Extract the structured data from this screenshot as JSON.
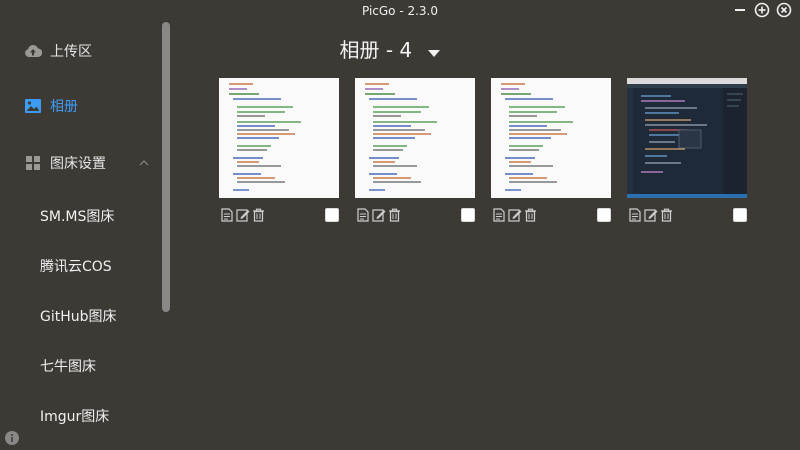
{
  "window": {
    "title": "PicGo - 2.3.0"
  },
  "sidebar": {
    "items": [
      {
        "label": "上传区",
        "icon": "cloud-upload-icon"
      },
      {
        "label": "相册",
        "icon": "image-icon",
        "active": true
      },
      {
        "label": "图床设置",
        "icon": "grid-icon",
        "expanded": true
      }
    ],
    "sub_items": [
      "SM.MS图床",
      "腾讯云COS",
      "GitHub图床",
      "七牛图床",
      "Imgur图床"
    ]
  },
  "gallery": {
    "title": "相册 - 4",
    "cards": [
      {
        "thumb": "code-screenshot-light"
      },
      {
        "thumb": "code-screenshot-light"
      },
      {
        "thumb": "code-screenshot-light"
      },
      {
        "thumb": "code-screenshot-dark"
      }
    ]
  },
  "colors": {
    "background": "#3d3a36",
    "accent": "#3c9cf5",
    "text": "#e8e8e8"
  }
}
